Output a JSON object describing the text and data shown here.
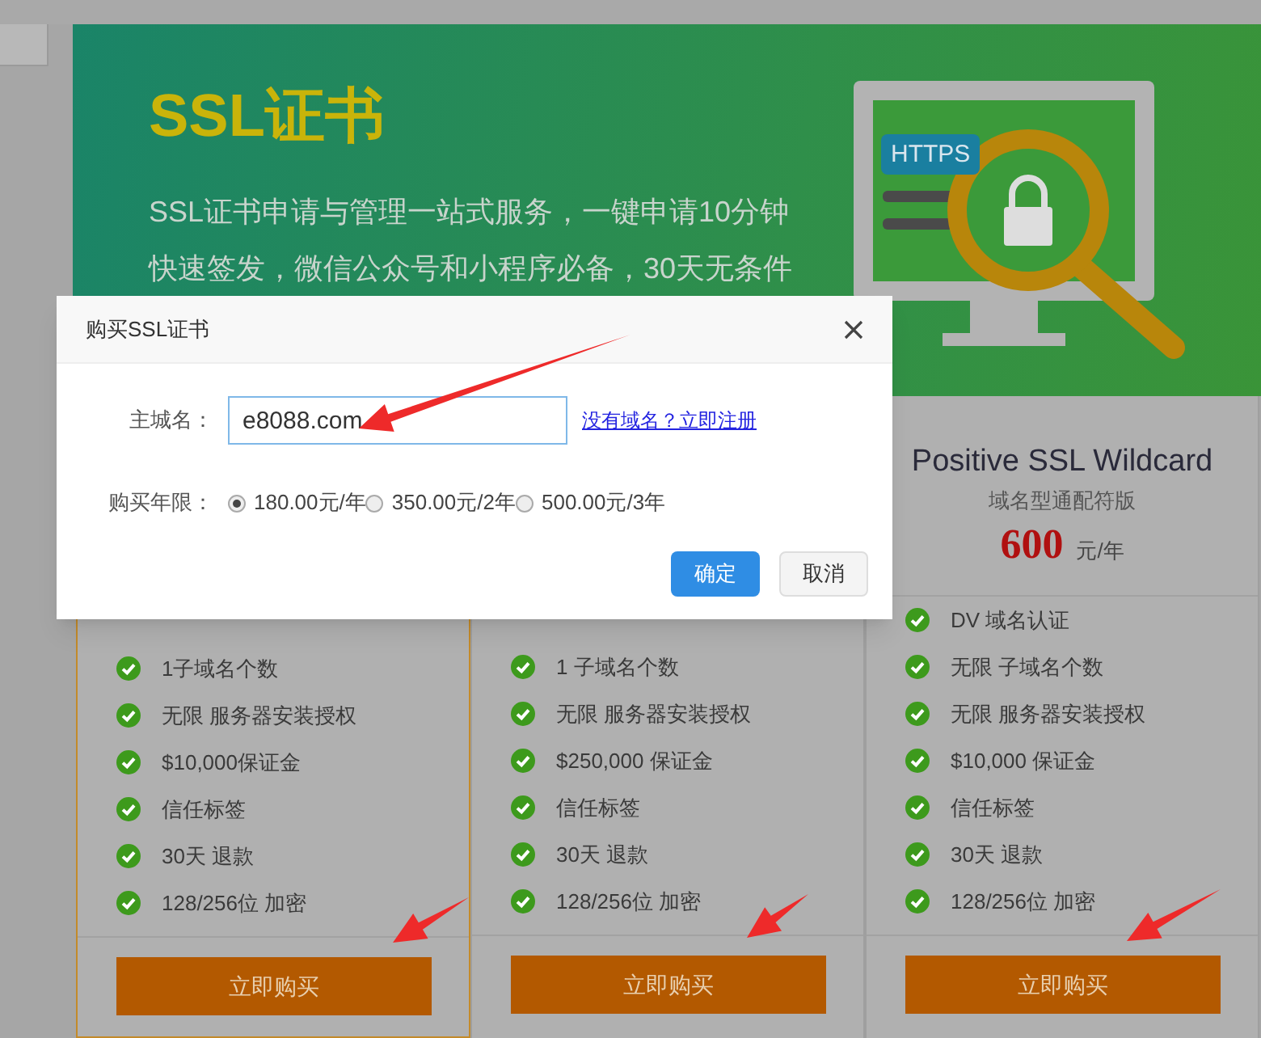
{
  "banner": {
    "title": "SSL证书",
    "description": [
      "SSL证书申请与管理一站式服务，一键申请10分钟",
      "快速签发，微信公众号和小程序必备，30天无条件"
    ],
    "badge": "HTTPS"
  },
  "plans": [
    {
      "selected": true,
      "features": [
        "1子域名个数",
        "无限 服务器安装授权",
        "$10,000保证金",
        "信任标签",
        "30天 退款",
        "128/256位 加密"
      ],
      "button": "立即购买"
    },
    {
      "selected": false,
      "features": [
        "1 子域名个数",
        "无限 服务器安装授权",
        "$250,000 保证金",
        "信任标签",
        "30天 退款",
        "128/256位 加密"
      ],
      "button": "立即购买"
    },
    {
      "selected": false,
      "name": "Positive SSL Wildcard",
      "subtitle": "域名型通配符版",
      "price": "600",
      "unit": "元/年",
      "features": [
        "DV 域名认证",
        "无限 子域名个数",
        "无限 服务器安装授权",
        "$10,000 保证金",
        "信任标签",
        "30天 退款",
        "128/256位 加密"
      ],
      "button": "立即购买"
    }
  ],
  "dialog": {
    "title": "购买SSL证书",
    "domain_label": "主城名：",
    "domain_value": "e8088.com",
    "register_link": "没有域名？立即注册",
    "period_label": "购买年限：",
    "periods": [
      {
        "label": "180.00元/年",
        "selected": true
      },
      {
        "label": "350.00元/2年",
        "selected": false
      },
      {
        "label": "500.00元/3年",
        "selected": false
      }
    ],
    "buttons": [
      {
        "label": "确定",
        "kind": "primary"
      },
      {
        "label": "取消",
        "kind": "default"
      }
    ]
  }
}
